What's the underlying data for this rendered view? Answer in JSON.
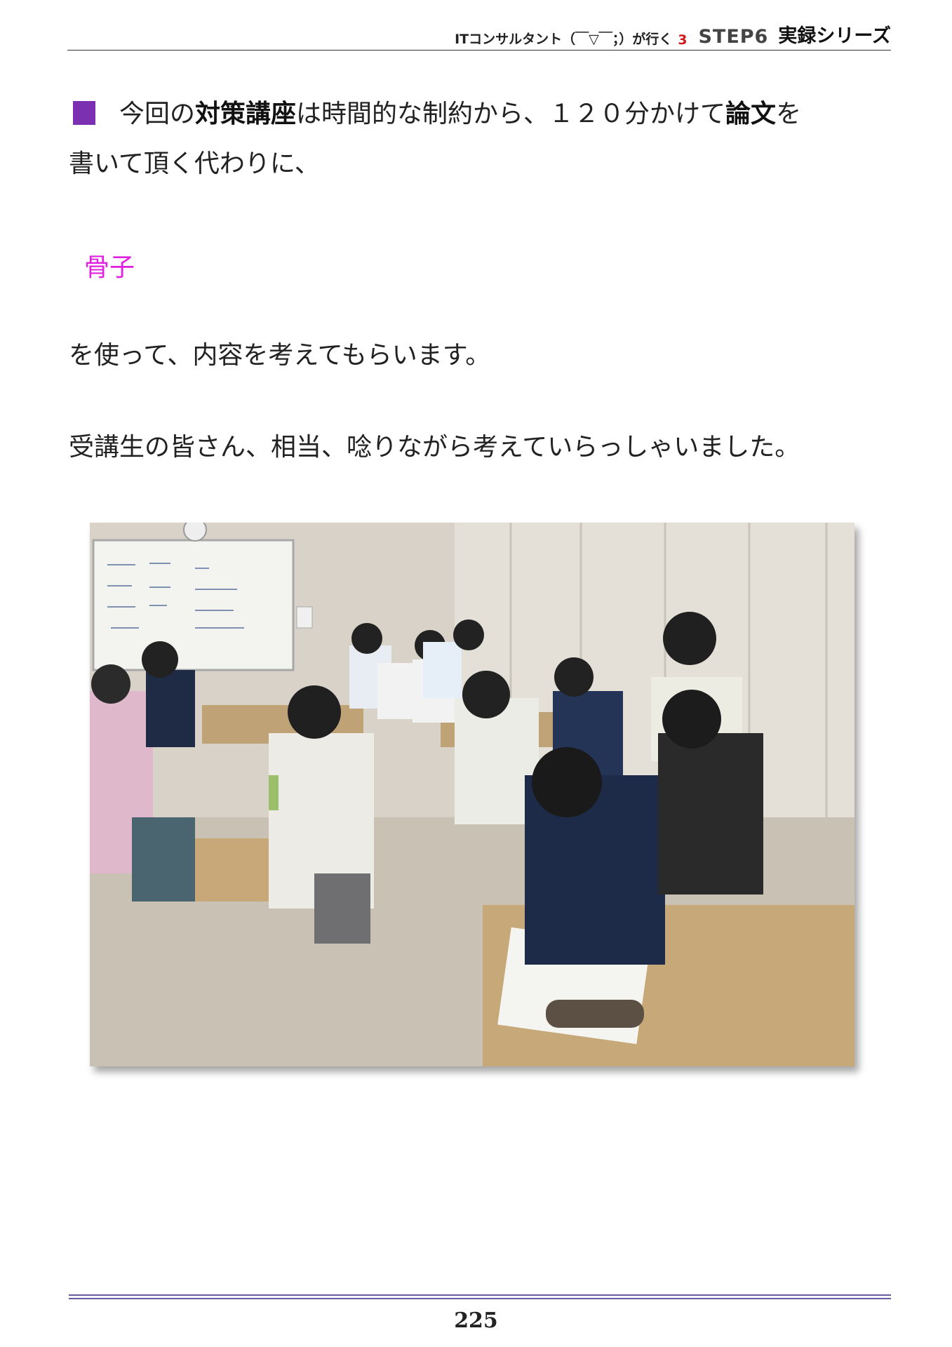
{
  "header": {
    "series": "ITコンサルタント（￣▽￣；）が行く",
    "volume": "3",
    "step": "STEP6",
    "series_title": "実録シリーズ"
  },
  "body": {
    "p1_a": "今回の",
    "p1_b": "対策講座",
    "p1_c": "は時間的な制約から、１２０分かけて",
    "p1_d": "論文",
    "p1_e": "を",
    "p1_line2": "書いて頂く代わりに、",
    "keyword": "骨子",
    "p2": "を使って、内容を考えてもらいます。",
    "p3": "受講生の皆さん、相当、唸りながら考えていらっしゃいました。"
  },
  "colors": {
    "marker": "#7a30b0",
    "keyword": "#e020e0",
    "volume": "#d01818"
  },
  "footer": {
    "page_number": "225"
  }
}
